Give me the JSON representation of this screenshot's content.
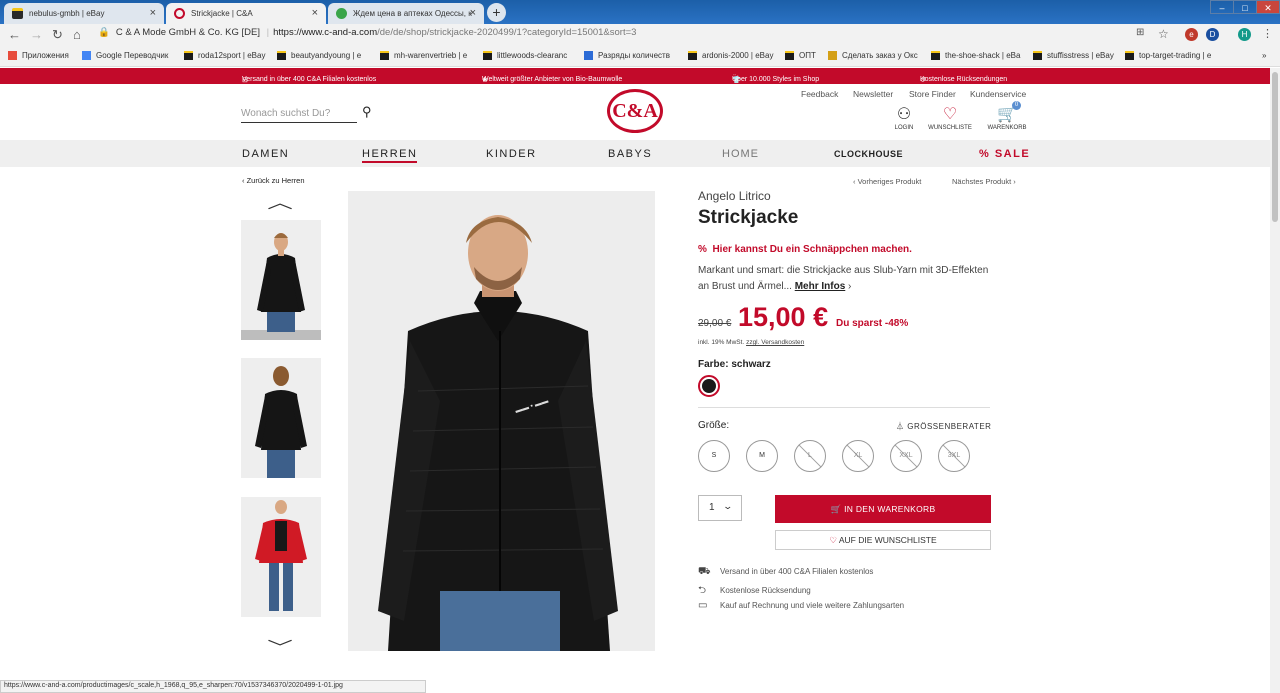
{
  "browser": {
    "tabs": [
      {
        "label": "nebulus-gmbh | eBay"
      },
      {
        "label": "Strickjacke | C&A"
      },
      {
        "label": "Ждем цена в аптеках Одессы, к"
      }
    ],
    "url_owner": "C & A Mode GmbH & Co. KG [DE]",
    "url_host": "https://www.c-and-a.com",
    "url_path": "/de/de/shop/strickjacke-2020499/1?categoryId=15001&sort=3",
    "bookmarks": [
      "Приложения",
      "Google Переводчик",
      "roda12sport | eBay",
      "beautyandyoung | e",
      "mh-warenvertrieb | e",
      "littlewoods-clearanc",
      "Разряды количеств",
      "ardonis-2000 | eBay",
      "ОПТ",
      "Сделать заказ у Окс",
      "the-shoe-shack | eBa",
      "stuffisstress | eBay",
      "top-target-trading | e"
    ],
    "bookmarks_more": "»",
    "status_url": "https://www.c-and-a.com/productimages/c_scale,h_1968,q_95,e_sharpen:70/v1537346370/2020499-1-01.jpg"
  },
  "promo": [
    "Versand in über 400 C&A Filialen kostenlos",
    "Weltweit größter Anbieter von Bio-Baumwolle",
    "Über 10.000 Styles im Shop",
    "Kostenlose Rücksendungen"
  ],
  "header": {
    "search_placeholder": "Wonach suchst Du?",
    "logo": "C&A",
    "links": [
      "Feedback",
      "Newsletter",
      "Store Finder",
      "Kundenservice"
    ],
    "login": "LOGIN",
    "wishlist": "WUNSCHLISTE",
    "cart": "WARENKORB",
    "cart_count": "0"
  },
  "nav": {
    "damen": "DAMEN",
    "herren": "HERREN",
    "kinder": "KINDER",
    "babys": "BABYS",
    "home": "HOME",
    "clockhouse": "CLOCKHOUSE",
    "sale": "SALE"
  },
  "product": {
    "back": "Zurück zu Herren",
    "prev": "Vorheriges Produkt",
    "next": "Nächstes Produkt",
    "brand": "Angelo Litrico",
    "title": "Strickjacke",
    "deal": "Hier kannst Du ein Schnäppchen machen.",
    "desc": "Markant und smart: die Strickjacke aus Slub-Yarn mit 3D-Effekten an Brust und Ärmel...",
    "more": "Mehr Infos",
    "old_price": "29,00 €",
    "price": "15,00 €",
    "save": "Du sparst -48%",
    "tax": "inkl. 19% MwSt.",
    "shipping": "zzgl. Versandkosten",
    "color_label": "Farbe:",
    "color_value": "schwarz",
    "size_label": "Größe:",
    "size_advisor": "GRÖSSENBERATER",
    "sizes": [
      "S",
      "M",
      "L",
      "XL",
      "XXL",
      "3XL"
    ],
    "qty": "1",
    "add_to_cart": "IN DEN WARENKORB",
    "add_to_wishlist": "AUF DIE WUNSCHLISTE",
    "benefits": [
      "Versand in über 400 C&A Filialen kostenlos",
      "Kostenlose Rücksendung",
      "Kauf auf Rechnung und viele weitere Zahlungsarten"
    ]
  },
  "colors": {
    "brand": "#c20a2a",
    "nav_bg": "#efefef"
  }
}
